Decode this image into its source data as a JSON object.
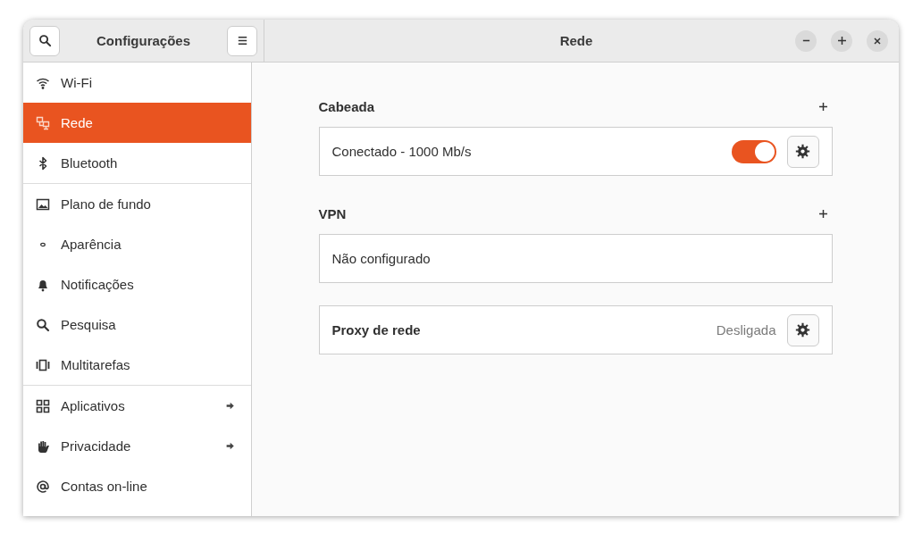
{
  "window": {
    "title": "Rede"
  },
  "sidebar": {
    "title": "Configurações",
    "groups": [
      {
        "items": [
          {
            "kind": "wifi",
            "label": "Wi-Fi",
            "selected": false,
            "submenu": false
          },
          {
            "kind": "network",
            "label": "Rede",
            "selected": true,
            "submenu": false
          },
          {
            "kind": "bluetooth",
            "label": "Bluetooth",
            "selected": false,
            "submenu": false
          }
        ]
      },
      {
        "items": [
          {
            "kind": "image",
            "label": "Plano de fundo",
            "selected": false,
            "submenu": false
          },
          {
            "kind": "appearance",
            "label": "Aparência",
            "selected": false,
            "submenu": false
          },
          {
            "kind": "bell",
            "label": "Notificações",
            "selected": false,
            "submenu": false
          },
          {
            "kind": "search",
            "label": "Pesquisa",
            "selected": false,
            "submenu": false
          },
          {
            "kind": "multitask",
            "label": "Multitarefas",
            "selected": false,
            "submenu": false
          }
        ]
      },
      {
        "items": [
          {
            "kind": "grid",
            "label": "Aplicativos",
            "selected": false,
            "submenu": true
          },
          {
            "kind": "hand",
            "label": "Privacidade",
            "selected": false,
            "submenu": true
          },
          {
            "kind": "at",
            "label": "Contas on-line",
            "selected": false,
            "submenu": false
          }
        ]
      }
    ]
  },
  "sections": [
    {
      "heading": "Cabeada",
      "rows": [
        {
          "kind": "switch",
          "label": "Conectado - 1000 Mb/s",
          "on": true
        }
      ]
    },
    {
      "heading": "VPN",
      "rows": [
        {
          "kind": "plain",
          "label": "Não configurado"
        }
      ]
    },
    {
      "rows": [
        {
          "kind": "status",
          "label": "Proxy de rede",
          "status": "Desligada"
        }
      ]
    }
  ]
}
